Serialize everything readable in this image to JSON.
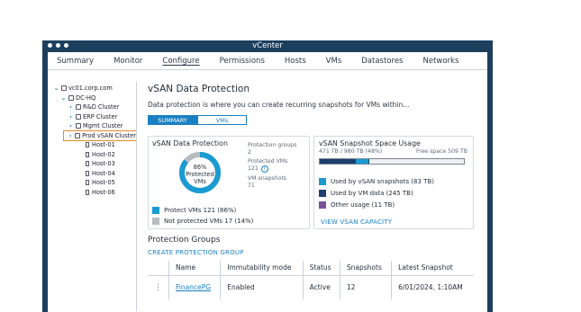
{
  "window": {
    "title": "vCenter"
  },
  "tabs": [
    "Summary",
    "Monitor",
    "Configure",
    "Permissions",
    "Hosts",
    "VMs",
    "Datastores",
    "Networks"
  ],
  "active_tab": "Configure",
  "tree": {
    "root": "vc01.corp.com",
    "datacenter": "DC-HQ",
    "clusters": [
      "R&D Cluster",
      "ERP Cluster",
      "Mgmt Cluster",
      "Prod vSAN Cluster"
    ],
    "selected_cluster": "Prod vSAN Cluster",
    "hosts": [
      "Host-01",
      "Host-02",
      "Host-03",
      "Host-04",
      "Host-05",
      "Host-06"
    ]
  },
  "page": {
    "title": "vSAN Data Protection",
    "description": "Data protection is where you can create recurring snapshots for VMs within...",
    "seg_summary": "SUMMARY",
    "seg_vms": "VMs"
  },
  "protection_card": {
    "title": "vSAN Data Protection",
    "donut_pct": "86%",
    "donut_label1": "Protected",
    "donut_label2": "VMs",
    "protected_fraction": 0.86,
    "groups_label": "Protection groups",
    "groups_value": "2",
    "pvms_label1": "Protected VMs",
    "pvms_value": "121",
    "snaps_label": "VM snapshots",
    "snaps_value": "71",
    "legend_protect": "Protect VMs  121  (86%)",
    "legend_not": "Not protected VMs  17  (14%)",
    "colors": {
      "protected": "#1a9bd1",
      "not_protected": "#b8bcc0"
    }
  },
  "space_card": {
    "title": "vSAN Snapshot Space Usage",
    "used_text": "471 TB / 980 TB (48%)",
    "free_text": "Free space  509 TB",
    "usage": {
      "snapshots_tb": 83,
      "vm_data_tb": 245,
      "other_tb": 11,
      "total_tb": 980,
      "used_tb": 471
    },
    "legend_snap": "Used by vSAN snapshots (83 TB)",
    "legend_vm": "Used by VM data (245 TB)",
    "legend_other": "Other usage (11 TB)",
    "link": "VIEW VSAN CAPACITY",
    "colors": {
      "snapshots": "#1a9bd1",
      "vm_data": "#1c3f6e",
      "other": "#7b4f9a"
    }
  },
  "groups": {
    "title": "Protection Groups",
    "create_link": "CREATE PROTECTION GROUP",
    "headers": [
      "Name",
      "Immutability mode",
      "Status",
      "Snapshots",
      "Latest Snapshot"
    ],
    "rows": [
      [
        "FinancePG",
        "Enabled",
        "Active",
        "12",
        "6/01/2024, 1:10AM"
      ]
    ]
  }
}
